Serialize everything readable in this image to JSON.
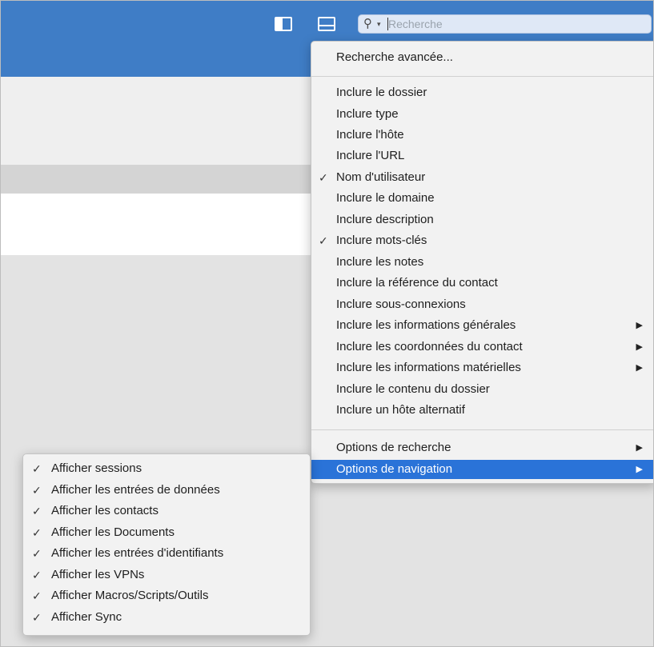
{
  "toolbar": {
    "icons": [
      "sidebar-toggle-icon",
      "bottom-panel-icon",
      "search-icon"
    ]
  },
  "search": {
    "placeholder": "Recherche"
  },
  "search_menu": {
    "advanced": "Recherche avancée...",
    "items": [
      {
        "label": "Inclure le dossier",
        "checked": false
      },
      {
        "label": "Inclure type",
        "checked": false
      },
      {
        "label": "Inclure l'hôte",
        "checked": false
      },
      {
        "label": "Inclure l'URL",
        "checked": false
      },
      {
        "label": "Nom d'utilisateur",
        "checked": true
      },
      {
        "label": "Inclure le domaine",
        "checked": false
      },
      {
        "label": "Inclure description",
        "checked": false
      },
      {
        "label": "Inclure mots-clés",
        "checked": true
      },
      {
        "label": "Inclure les notes",
        "checked": false
      },
      {
        "label": "Inclure la référence du contact",
        "checked": false
      },
      {
        "label": "Inclure sous-connexions",
        "checked": false
      },
      {
        "label": "Inclure les informations générales",
        "checked": false,
        "submenu": true
      },
      {
        "label": "Inclure les coordonnées du contact",
        "checked": false,
        "submenu": true
      },
      {
        "label": "Inclure les informations matérielles",
        "checked": false,
        "submenu": true
      },
      {
        "label": "Inclure le contenu du dossier",
        "checked": false
      },
      {
        "label": "Inclure un hôte alternatif",
        "checked": false
      }
    ],
    "options": [
      {
        "label": "Options de recherche",
        "submenu": true,
        "highlighted": false
      },
      {
        "label": "Options de navigation",
        "submenu": true,
        "highlighted": true
      }
    ],
    "check_glyph": "✓",
    "arrow_glyph": "▶"
  },
  "navigation_menu": {
    "items": [
      {
        "label": "Afficher sessions",
        "checked": true
      },
      {
        "label": "Afficher les entrées de données",
        "checked": true
      },
      {
        "label": "Afficher les contacts",
        "checked": true
      },
      {
        "label": "Afficher les Documents",
        "checked": true
      },
      {
        "label": "Afficher les entrées d'identifiants",
        "checked": true
      },
      {
        "label": "Afficher les VPNs",
        "checked": true
      },
      {
        "label": "Afficher Macros/Scripts/Outils",
        "checked": true
      },
      {
        "label": "Afficher Sync",
        "checked": true
      }
    ]
  },
  "colors": {
    "toolbar": "#3f7dc6",
    "highlight": "#2a73d8",
    "menu_bg": "#f2f2f2"
  }
}
